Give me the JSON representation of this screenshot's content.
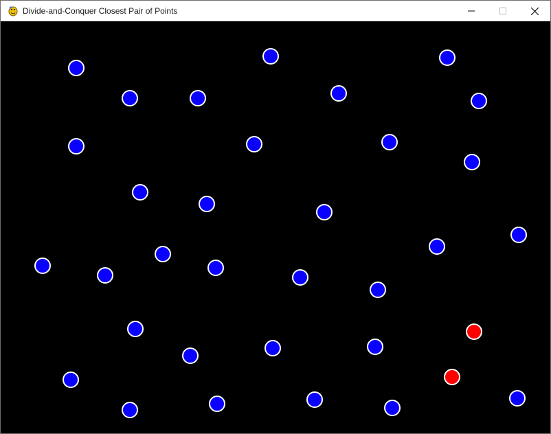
{
  "window": {
    "title": "Divide-and-Conquer Closest Pair of Points",
    "app_icon": "python-snake-icon",
    "controls": [
      "minimize-icon",
      "maximize-icon",
      "close-icon"
    ]
  },
  "colors": {
    "background": "#000000",
    "point_fill": "#0a00ff",
    "closest_pair_fill": "#ff0000",
    "point_outline": "#ffffff"
  }
}
